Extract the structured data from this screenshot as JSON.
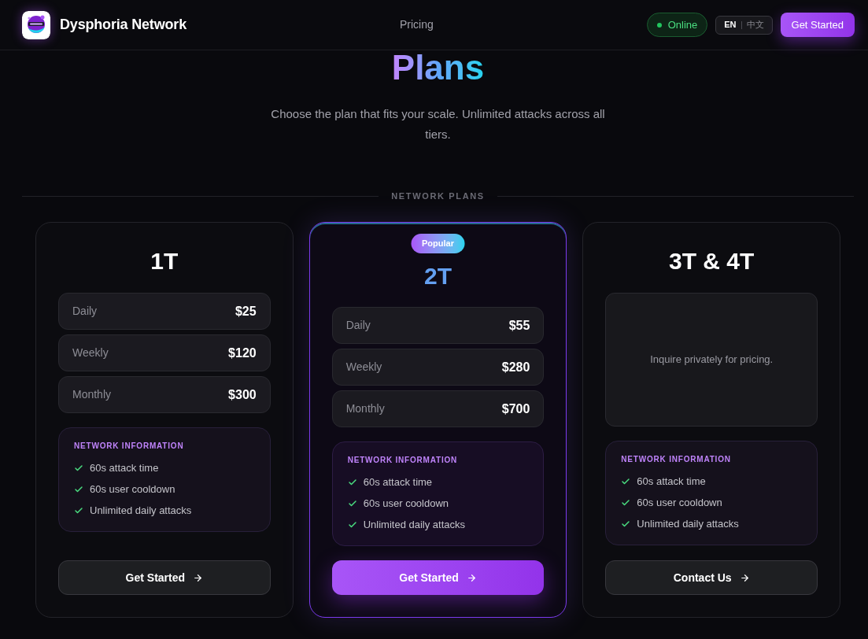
{
  "header": {
    "brand": "Dysphoria Network",
    "nav": [
      {
        "label": "Pricing"
      }
    ],
    "status": {
      "label": "Online",
      "online": true
    },
    "languages": [
      {
        "label": "EN",
        "selected": true
      },
      {
        "label": "中文",
        "selected": false
      }
    ],
    "cta": "Get Started"
  },
  "hero": {
    "title": "Plans",
    "subtitle": "Choose the plan that fits your scale. Unlimited attacks across all tiers."
  },
  "section_label": "NETWORK PLANS",
  "plans": [
    {
      "kind": "prices",
      "name": "1T",
      "featured": false,
      "prices": [
        {
          "period": "Daily",
          "price": "$25"
        },
        {
          "period": "Weekly",
          "price": "$120"
        },
        {
          "period": "Monthly",
          "price": "$300"
        }
      ],
      "info_title": "NETWORK INFORMATION",
      "features": [
        "60s attack time",
        "60s user cooldown",
        "Unlimited daily attacks"
      ],
      "button": "Get Started"
    },
    {
      "kind": "prices",
      "name": "2T",
      "featured": true,
      "badge": "Popular",
      "prices": [
        {
          "period": "Daily",
          "price": "$55"
        },
        {
          "period": "Weekly",
          "price": "$280"
        },
        {
          "period": "Monthly",
          "price": "$700"
        }
      ],
      "info_title": "NETWORK INFORMATION",
      "features": [
        "60s attack time",
        "60s user cooldown",
        "Unlimited daily attacks"
      ],
      "button": "Get Started"
    },
    {
      "kind": "inquiry",
      "name": "3T & 4T",
      "featured": false,
      "note": "Inquire privately for pricing.",
      "info_title": "NETWORK INFORMATION",
      "features": [
        "60s attack time",
        "60s user cooldown",
        "Unlimited daily attacks"
      ],
      "button": "Contact Us"
    }
  ]
}
